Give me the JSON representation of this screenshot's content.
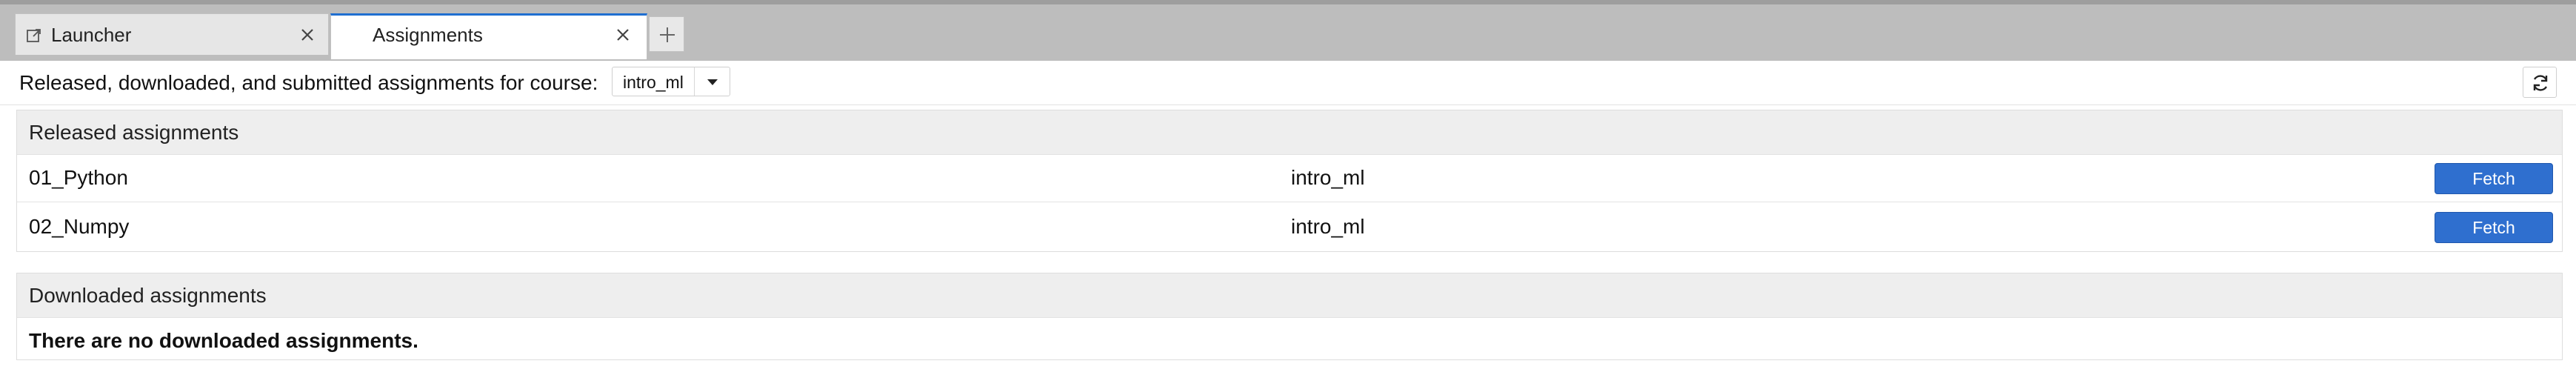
{
  "tabs": [
    {
      "label": "Launcher",
      "icon": "external-launch-icon",
      "active": false
    },
    {
      "label": "Assignments",
      "active": true
    }
  ],
  "new_tab_icon": "plus-icon",
  "course_selector": {
    "label": "Released, downloaded, and submitted assignments for course:",
    "selected": "intro_ml"
  },
  "refresh_icon": "refresh-icon",
  "released": {
    "title": "Released assignments",
    "rows": [
      {
        "name": "01_Python",
        "course": "intro_ml",
        "action": "Fetch"
      },
      {
        "name": "02_Numpy",
        "course": "intro_ml",
        "action": "Fetch"
      }
    ]
  },
  "downloaded": {
    "title": "Downloaded assignments",
    "empty_message": "There are no downloaded assignments."
  },
  "colors": {
    "accent": "#2f6fcf",
    "active_tab_border": "#1f6fd1",
    "tabbar_bg": "#bdbdbd",
    "panel_header_bg": "#eeeeee"
  }
}
